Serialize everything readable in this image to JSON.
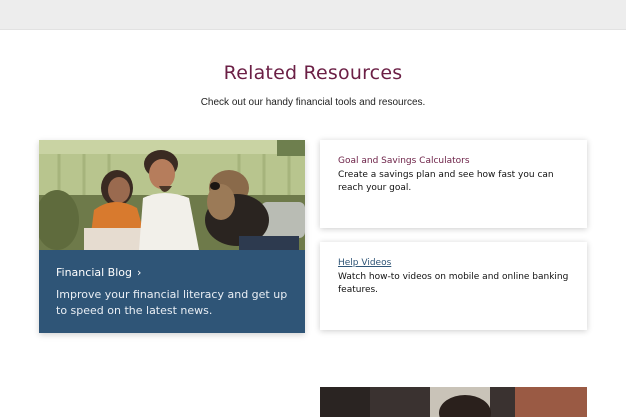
{
  "section": {
    "title": "Related Resources",
    "subtitle": "Check out our handy financial tools and resources."
  },
  "blog_card": {
    "title": "Financial Blog",
    "chevron": "›",
    "description": "Improve your financial literacy and get up to speed on the latest news.",
    "photo_icon": "couple-with-dog-photo"
  },
  "calculators_card": {
    "title": "Goal and Savings Calculators",
    "description": "Create a savings plan and see how fast you can reach your goal."
  },
  "videos_card": {
    "title": "Help Videos",
    "description": "Watch how-to videos on mobile and online banking features."
  },
  "colors": {
    "accent": "#6b1f45",
    "blog_bg": "#2f5577",
    "link": "#2f5577"
  }
}
